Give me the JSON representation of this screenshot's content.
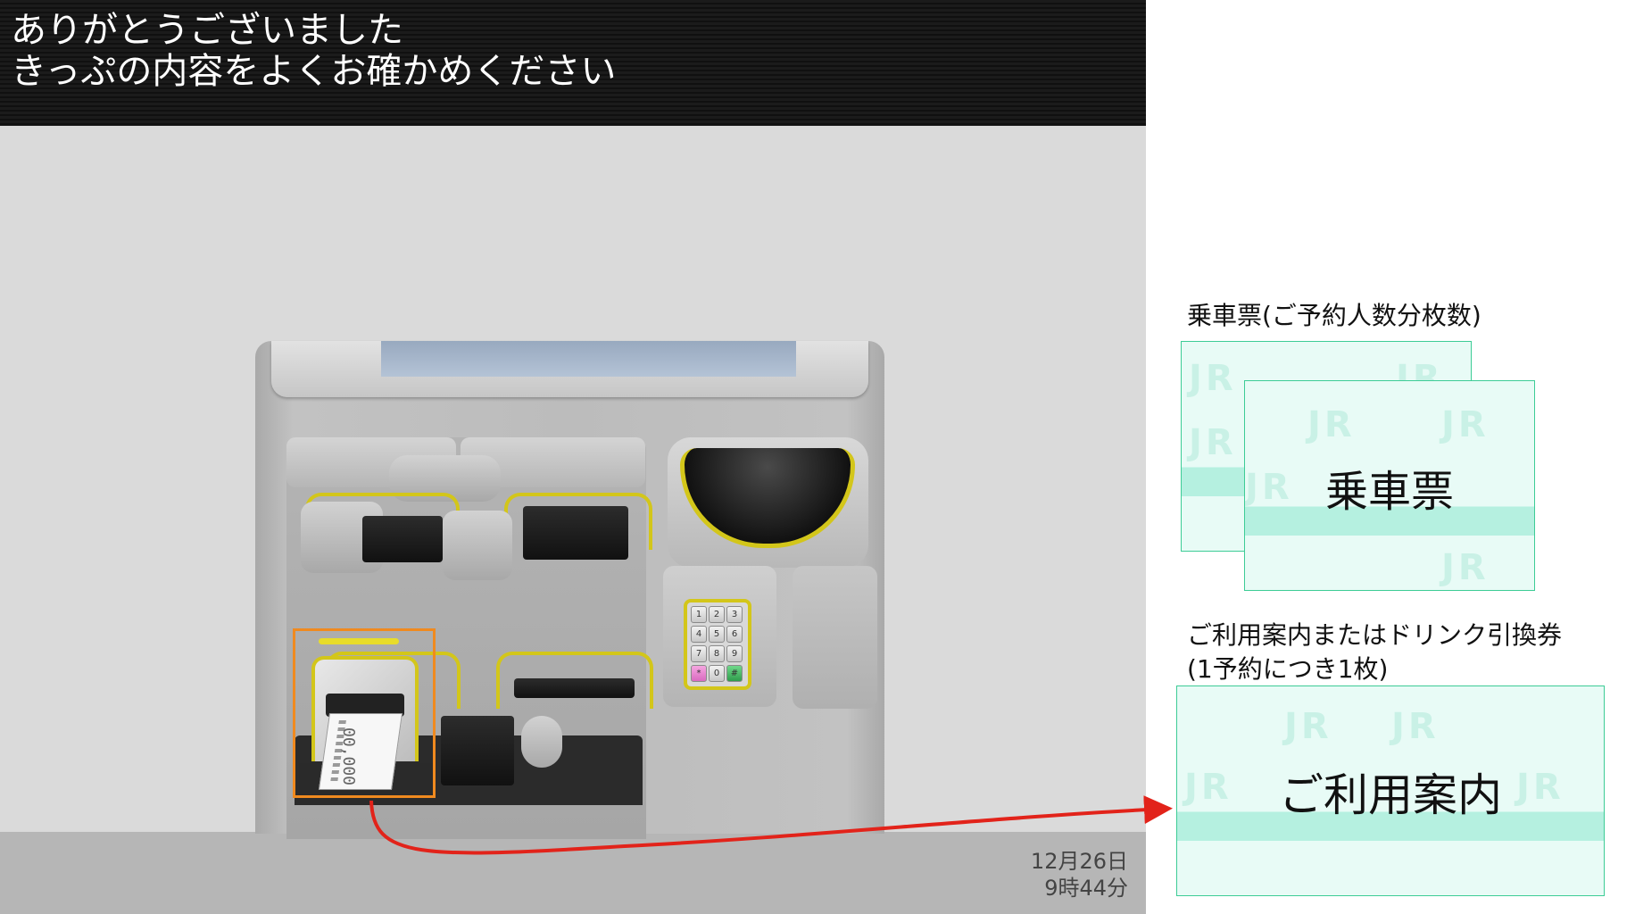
{
  "header": {
    "line1": "ありがとうございました",
    "line2": "きっぷの内容をよくお確かめください"
  },
  "status": {
    "date": "12月26日",
    "time": "9時44分"
  },
  "machine": {
    "keypad_keys": [
      "1",
      "2",
      "3",
      "4",
      "5",
      "6",
      "7",
      "8",
      "9",
      "*",
      "0",
      "#"
    ],
    "ticket_digits": "00,000"
  },
  "outputs": {
    "boarding_ticket_caption": "乗車票(ご予約人数分枚数)",
    "boarding_ticket_label": "乗車票",
    "guide_caption_line1": "ご利用案内またはドリンク引換券",
    "guide_caption_line2": "(1予約につき1枚)",
    "guide_ticket_label": "ご利用案内",
    "watermark": "JR"
  },
  "colors": {
    "highlight_box": "#f08a1f",
    "arrow": "#e2231a",
    "ticket_border": "#3dcc96",
    "guide_yellow": "#d3c61a"
  }
}
